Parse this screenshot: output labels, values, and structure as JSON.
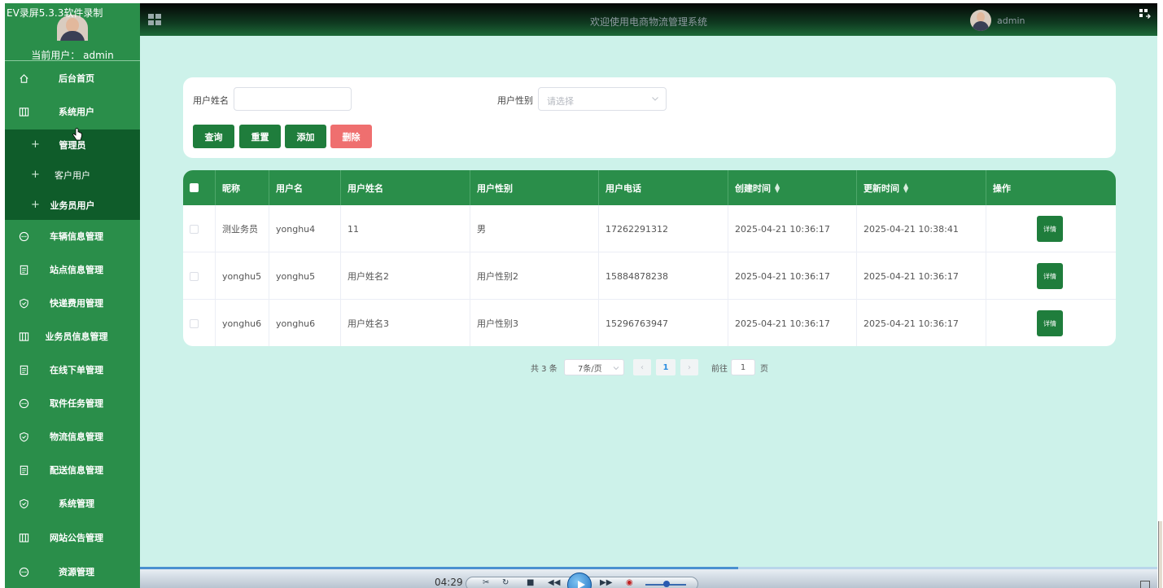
{
  "recorder_title": "EV录屏5.3.3软件录制",
  "sidebar": {
    "current_user": "当前用户： admin",
    "items": [
      {
        "label": "后台首页",
        "icon": "home-icon"
      },
      {
        "label": "系统用户",
        "icon": "columns-icon"
      },
      {
        "label": "管理员",
        "icon": "plus-icon"
      },
      {
        "label": "客户用户",
        "icon": "plus-icon"
      },
      {
        "label": "业务员用户",
        "icon": "plus-icon"
      },
      {
        "label": "车辆信息管理",
        "icon": "chat-icon"
      },
      {
        "label": "站点信息管理",
        "icon": "document-icon"
      },
      {
        "label": "快递费用管理",
        "icon": "shield-icon"
      },
      {
        "label": "业务员信息管理",
        "icon": "columns-icon"
      },
      {
        "label": "在线下单管理",
        "icon": "document-icon"
      },
      {
        "label": "取件任务管理",
        "icon": "chat-icon"
      },
      {
        "label": "物流信息管理",
        "icon": "shield-icon"
      },
      {
        "label": "配送信息管理",
        "icon": "document-icon"
      },
      {
        "label": "系统管理",
        "icon": "shield-icon"
      },
      {
        "label": "网站公告管理",
        "icon": "columns-icon"
      },
      {
        "label": "资源管理",
        "icon": "chat-icon"
      }
    ]
  },
  "header": {
    "title": "欢迎使用电商物流管理系统",
    "user": "admin"
  },
  "search": {
    "name_label": "用户姓名",
    "name_value": "",
    "gender_label": "用户性别",
    "gender_placeholder": "请选择",
    "buttons": {
      "query": "查询",
      "reset": "重置",
      "add": "添加",
      "delete": "删除"
    }
  },
  "table": {
    "columns": [
      "昵称",
      "用户名",
      "用户姓名",
      "用户性别",
      "用户电话",
      "创建时间",
      "更新时间",
      "操作"
    ],
    "rows": [
      {
        "nickname": "测业务员",
        "username": "yonghu4",
        "realname": "11",
        "gender": "男",
        "phone": "17262291312",
        "created": "2025-04-21 10:36:17",
        "updated": "2025-04-21 10:38:41",
        "action": "详情"
      },
      {
        "nickname": "yonghu5",
        "username": "yonghu5",
        "realname": "用户姓名2",
        "gender": "用户性别2",
        "phone": "15884878238",
        "created": "2025-04-21 10:36:17",
        "updated": "2025-04-21 10:36:17",
        "action": "详情"
      },
      {
        "nickname": "yonghu6",
        "username": "yonghu6",
        "realname": "用户姓名3",
        "gender": "用户性别3",
        "phone": "15296763947",
        "created": "2025-04-21 10:36:17",
        "updated": "2025-04-21 10:36:17",
        "action": "详情"
      }
    ]
  },
  "pagination": {
    "total": "共 3 条",
    "page_size": "7条/页",
    "current": "1",
    "goto_label": "前往",
    "goto_value": "1",
    "page_unit": "页"
  },
  "player": {
    "time": "04:29",
    "progress": 0.588
  }
}
